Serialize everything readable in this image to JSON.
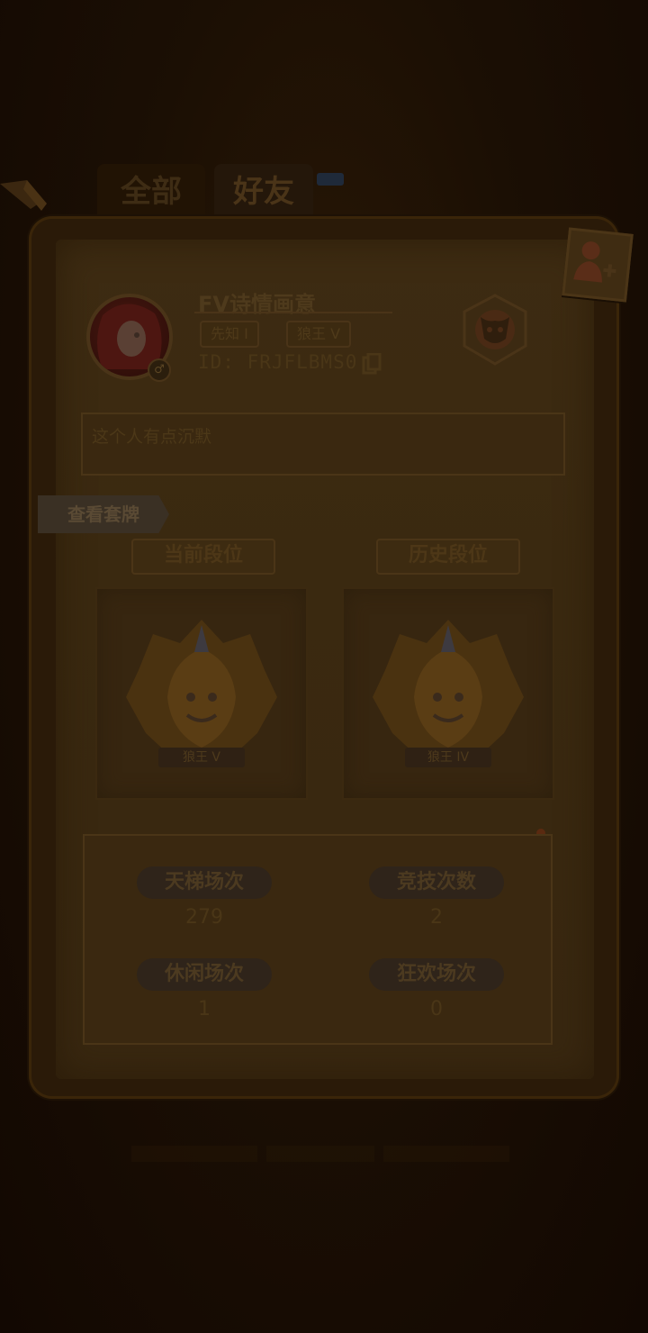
{
  "tabs": [
    {
      "label": "全部"
    },
    {
      "label": "好友"
    }
  ],
  "profile": {
    "name": "FV诗情画意",
    "badges": [
      "先知 I",
      "狼王 V"
    ],
    "id_text": "ID: FRJFLBMS0",
    "signature": "这个人有点沉默"
  },
  "actions": {
    "view_cards": "查看套牌"
  },
  "ranks": {
    "current_title": "当前段位",
    "history_title": "历史段位",
    "current_label": "狼王 V",
    "history_label": "狼王 IV"
  },
  "stats": [
    {
      "label": "天梯场次",
      "value": "279"
    },
    {
      "label": "竞技次数",
      "value": "2"
    },
    {
      "label": "休闲场次",
      "value": "1"
    },
    {
      "label": "狂欢场次",
      "value": "0"
    }
  ],
  "colors": {
    "background": "#170c03",
    "card": "#3d2b12",
    "text": "#4d3717"
  }
}
